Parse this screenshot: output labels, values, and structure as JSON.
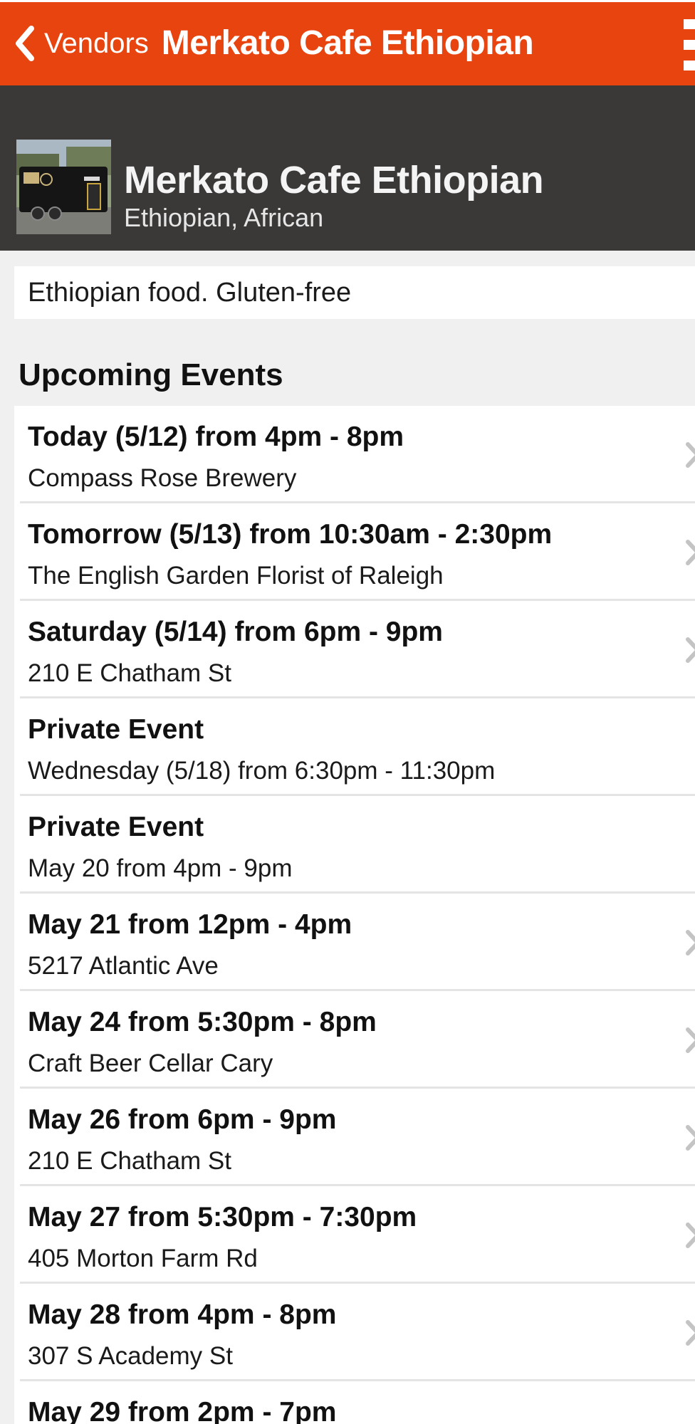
{
  "nav": {
    "back_label": "Vendors",
    "title": "Merkato Cafe Ethiopian",
    "back_icon": "chevron-left-icon",
    "menu_icon": "hamburger-menu-icon",
    "bar_color": "#e8440f"
  },
  "vendor": {
    "name": "Merkato Cafe Ethiopian",
    "cuisine": "Ethiopian, African",
    "description": "Ethiopian food. Gluten-free"
  },
  "section": {
    "title": "Upcoming Events"
  },
  "events": [
    {
      "when_bold": "Today (5/12) from 4pm - 8pm",
      "detail": "Compass Rose Brewery",
      "has_link": true
    },
    {
      "when_bold": "Tomorrow (5/13) from 10:30am - 2:30pm",
      "detail": "The English Garden Florist of Raleigh",
      "has_link": true
    },
    {
      "when_bold": "Saturday (5/14) from 6pm - 9pm",
      "detail": "210 E Chatham St",
      "has_link": true
    },
    {
      "when_bold": "Private Event",
      "detail": "Wednesday (5/18) from 6:30pm - 11:30pm",
      "has_link": false
    },
    {
      "when_bold": "Private Event",
      "detail": "May 20 from 4pm - 9pm",
      "has_link": false
    },
    {
      "when_bold": "May 21 from 12pm - 4pm",
      "detail": "5217 Atlantic Ave",
      "has_link": true
    },
    {
      "when_bold": "May 24 from 5:30pm - 8pm",
      "detail": "Craft Beer Cellar Cary",
      "has_link": true
    },
    {
      "when_bold": "May 26 from 6pm - 9pm",
      "detail": "210 E Chatham St",
      "has_link": true
    },
    {
      "when_bold": "May 27 from 5:30pm - 7:30pm",
      "detail": "405 Morton Farm Rd",
      "has_link": true
    },
    {
      "when_bold": "May 28 from 4pm - 8pm",
      "detail": "307 S Academy St",
      "has_link": true
    },
    {
      "when_bold": "May 29 from 2pm - 7pm",
      "detail": "",
      "has_link": true
    }
  ]
}
